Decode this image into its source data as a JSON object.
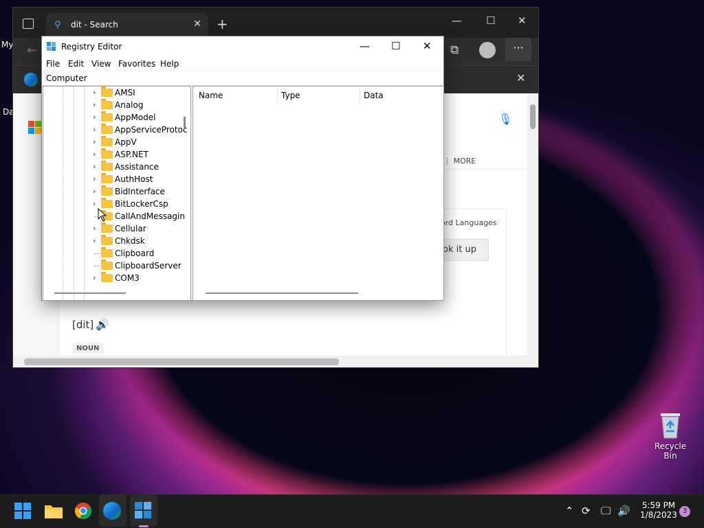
{
  "desktop": {
    "left_label_1": "My",
    "left_label_2": "Da",
    "recycle_bin_label": "Recycle Bin"
  },
  "edge": {
    "tab_title": "dit - Search",
    "content": {
      "more_label": "MORE",
      "word_languages": "ord Languages",
      "look_it_up": "ok it up",
      "pronunciation": "[dit]",
      "pos_badge": "NOUN"
    }
  },
  "regedit": {
    "title": "Registry Editor",
    "menu": [
      "File",
      "Edit",
      "View",
      "Favorites",
      "Help"
    ],
    "address": "Computer",
    "columns": [
      "Name",
      "Type",
      "Data"
    ],
    "tree": [
      {
        "label": "AMSI",
        "expandable": true
      },
      {
        "label": "Analog",
        "expandable": true
      },
      {
        "label": "AppModel",
        "expandable": true
      },
      {
        "label": "AppServiceProtoc",
        "expandable": true
      },
      {
        "label": "AppV",
        "expandable": true
      },
      {
        "label": "ASP.NET",
        "expandable": true
      },
      {
        "label": "Assistance",
        "expandable": true
      },
      {
        "label": "AuthHost",
        "expandable": true
      },
      {
        "label": "BidInterface",
        "expandable": true
      },
      {
        "label": "BitLockerCsp",
        "expandable": true
      },
      {
        "label": "CallAndMessagin",
        "expandable": false
      },
      {
        "label": "Cellular",
        "expandable": true
      },
      {
        "label": "Chkdsk",
        "expandable": true
      },
      {
        "label": "Clipboard",
        "expandable": false
      },
      {
        "label": "ClipboardServer",
        "expandable": false
      },
      {
        "label": "COM3",
        "expandable": true
      }
    ]
  },
  "taskbar": {
    "time": "5:59 PM",
    "date": "1/8/2023",
    "notification_count": "3"
  }
}
